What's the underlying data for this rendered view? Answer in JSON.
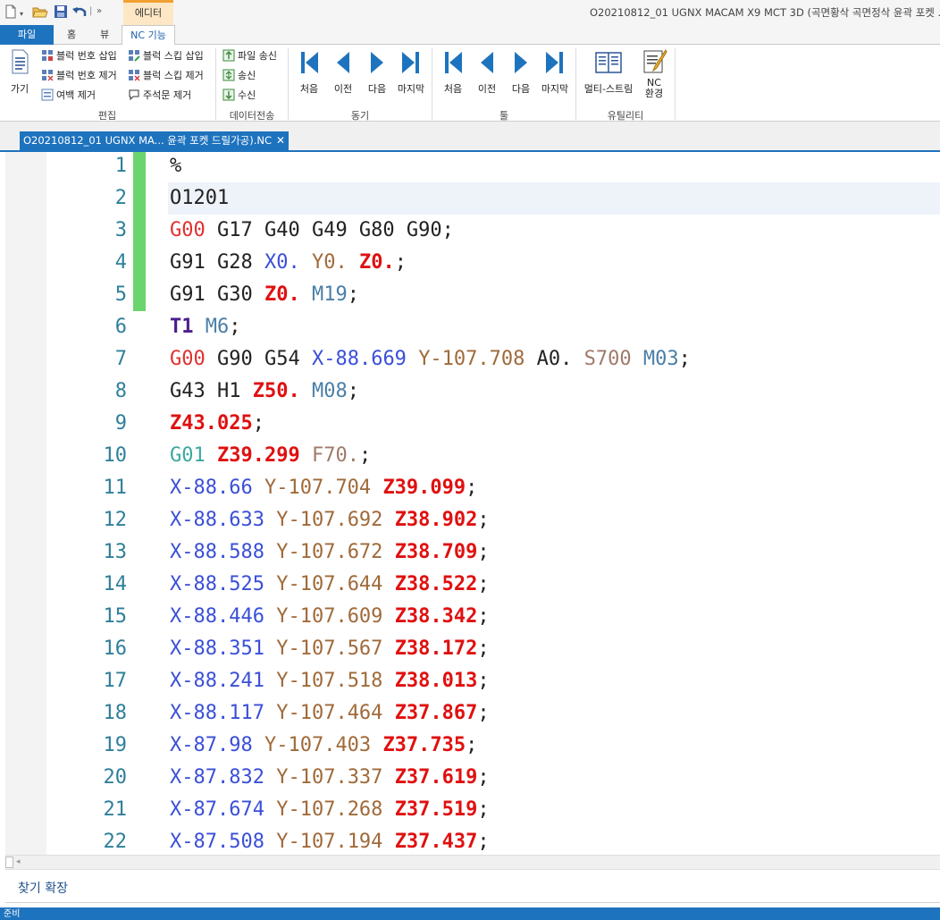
{
  "titlebar": {
    "context_tab": "에디터",
    "window_title": "O20210812_01 UGNX MACAM X9 MCT 3D (곡면황삭 곡면정삭 윤곽 포켓 ..."
  },
  "tabs": {
    "file": "파일",
    "home": "홈",
    "view": "뷰",
    "nc": "NC 기능"
  },
  "ribbon": {
    "go": "가기",
    "insert_block_number": "블럭 번호 삽입",
    "remove_block_number": "블럭 번호 제거",
    "remove_blank": "여백 제거",
    "insert_block_skip": "블럭 스킵 삽입",
    "remove_block_skip": "블럭 스킵 제거",
    "remove_comment": "주석문 제거",
    "edit_group": "편집",
    "send_file": "파일 송신",
    "send": "송신",
    "receive": "수신",
    "transfer_group": "데이터전송",
    "sync_first": "처음",
    "sync_prev": "이전",
    "sync_next": "다음",
    "sync_last": "마지막",
    "sync_group": "동기",
    "tool_first": "처음",
    "tool_prev": "이전",
    "tool_next": "다음",
    "tool_last": "마지막",
    "tool_group": "툴",
    "multi_stream": "멀티-스트림",
    "nc_env": "NC\n환경",
    "utility_group": "유틸리티"
  },
  "document_tab": {
    "title": "O20210812_01 UGNX MA... 윤곽 포켓 드릴가공).NC",
    "close": "✕"
  },
  "colors": {
    "g00": "#e03030",
    "g01": "#3aa8a0",
    "x": "#3a4fd8",
    "y": "#a06a3a",
    "z": "#e01010",
    "m": "#4a7fa8",
    "f": "#a07a6a",
    "t": "#4b1e8c",
    "line_number": "#2f7f9a",
    "default": "#222222"
  },
  "code_lines": [
    {
      "n": "1",
      "tokens": [
        {
          "t": "%",
          "c": "default"
        }
      ]
    },
    {
      "n": "2",
      "tokens": [
        {
          "t": "O1201",
          "c": "default"
        }
      ]
    },
    {
      "n": "3",
      "tokens": [
        {
          "t": "G00",
          "c": "g00"
        },
        {
          "t": " G17 G40 G49 G80 G90;",
          "c": "default"
        }
      ]
    },
    {
      "n": "4",
      "tokens": [
        {
          "t": "G91 G28 ",
          "c": "default"
        },
        {
          "t": "X0.",
          "c": "x"
        },
        {
          "t": " ",
          "c": "default"
        },
        {
          "t": "Y0.",
          "c": "y"
        },
        {
          "t": " ",
          "c": "default"
        },
        {
          "t": "Z0.",
          "c": "z",
          "b": true
        },
        {
          "t": ";",
          "c": "default"
        }
      ]
    },
    {
      "n": "5",
      "tokens": [
        {
          "t": "G91 G30 ",
          "c": "default"
        },
        {
          "t": "Z0.",
          "c": "z",
          "b": true
        },
        {
          "t": " ",
          "c": "default"
        },
        {
          "t": "M19",
          "c": "m"
        },
        {
          "t": ";",
          "c": "default"
        }
      ]
    },
    {
      "n": "6",
      "tokens": [
        {
          "t": "T1",
          "c": "t",
          "b": true
        },
        {
          "t": " ",
          "c": "default"
        },
        {
          "t": "M6",
          "c": "m"
        },
        {
          "t": ";",
          "c": "default"
        }
      ]
    },
    {
      "n": "7",
      "tokens": [
        {
          "t": "G00",
          "c": "g00"
        },
        {
          "t": " G90 G54 ",
          "c": "default"
        },
        {
          "t": "X-88.669",
          "c": "x"
        },
        {
          "t": " ",
          "c": "default"
        },
        {
          "t": "Y-107.708",
          "c": "y"
        },
        {
          "t": " A0. ",
          "c": "default"
        },
        {
          "t": "S700",
          "c": "f"
        },
        {
          "t": " ",
          "c": "default"
        },
        {
          "t": "M03",
          "c": "m"
        },
        {
          "t": ";",
          "c": "default"
        }
      ]
    },
    {
      "n": "8",
      "tokens": [
        {
          "t": "G43 H1 ",
          "c": "default"
        },
        {
          "t": "Z50.",
          "c": "z",
          "b": true
        },
        {
          "t": " ",
          "c": "default"
        },
        {
          "t": "M08",
          "c": "m"
        },
        {
          "t": ";",
          "c": "default"
        }
      ]
    },
    {
      "n": "9",
      "tokens": [
        {
          "t": "Z43.025",
          "c": "z",
          "b": true
        },
        {
          "t": ";",
          "c": "default"
        }
      ]
    },
    {
      "n": "10",
      "tokens": [
        {
          "t": "G01",
          "c": "g01"
        },
        {
          "t": " ",
          "c": "default"
        },
        {
          "t": "Z39.299",
          "c": "z",
          "b": true
        },
        {
          "t": " ",
          "c": "default"
        },
        {
          "t": "F70.",
          "c": "f"
        },
        {
          "t": ";",
          "c": "default"
        }
      ]
    },
    {
      "n": "11",
      "tokens": [
        {
          "t": "X-88.66",
          "c": "x"
        },
        {
          "t": " ",
          "c": "default"
        },
        {
          "t": "Y-107.704",
          "c": "y"
        },
        {
          "t": " ",
          "c": "default"
        },
        {
          "t": "Z39.099",
          "c": "z",
          "b": true
        },
        {
          "t": ";",
          "c": "default"
        }
      ]
    },
    {
      "n": "12",
      "tokens": [
        {
          "t": "X-88.633",
          "c": "x"
        },
        {
          "t": " ",
          "c": "default"
        },
        {
          "t": "Y-107.692",
          "c": "y"
        },
        {
          "t": " ",
          "c": "default"
        },
        {
          "t": "Z38.902",
          "c": "z",
          "b": true
        },
        {
          "t": ";",
          "c": "default"
        }
      ]
    },
    {
      "n": "13",
      "tokens": [
        {
          "t": "X-88.588",
          "c": "x"
        },
        {
          "t": " ",
          "c": "default"
        },
        {
          "t": "Y-107.672",
          "c": "y"
        },
        {
          "t": " ",
          "c": "default"
        },
        {
          "t": "Z38.709",
          "c": "z",
          "b": true
        },
        {
          "t": ";",
          "c": "default"
        }
      ]
    },
    {
      "n": "14",
      "tokens": [
        {
          "t": "X-88.525",
          "c": "x"
        },
        {
          "t": " ",
          "c": "default"
        },
        {
          "t": "Y-107.644",
          "c": "y"
        },
        {
          "t": " ",
          "c": "default"
        },
        {
          "t": "Z38.522",
          "c": "z",
          "b": true
        },
        {
          "t": ";",
          "c": "default"
        }
      ]
    },
    {
      "n": "15",
      "tokens": [
        {
          "t": "X-88.446",
          "c": "x"
        },
        {
          "t": " ",
          "c": "default"
        },
        {
          "t": "Y-107.609",
          "c": "y"
        },
        {
          "t": " ",
          "c": "default"
        },
        {
          "t": "Z38.342",
          "c": "z",
          "b": true
        },
        {
          "t": ";",
          "c": "default"
        }
      ]
    },
    {
      "n": "16",
      "tokens": [
        {
          "t": "X-88.351",
          "c": "x"
        },
        {
          "t": " ",
          "c": "default"
        },
        {
          "t": "Y-107.567",
          "c": "y"
        },
        {
          "t": " ",
          "c": "default"
        },
        {
          "t": "Z38.172",
          "c": "z",
          "b": true
        },
        {
          "t": ";",
          "c": "default"
        }
      ]
    },
    {
      "n": "17",
      "tokens": [
        {
          "t": "X-88.241",
          "c": "x"
        },
        {
          "t": " ",
          "c": "default"
        },
        {
          "t": "Y-107.518",
          "c": "y"
        },
        {
          "t": " ",
          "c": "default"
        },
        {
          "t": "Z38.013",
          "c": "z",
          "b": true
        },
        {
          "t": ";",
          "c": "default"
        }
      ]
    },
    {
      "n": "18",
      "tokens": [
        {
          "t": "X-88.117",
          "c": "x"
        },
        {
          "t": " ",
          "c": "default"
        },
        {
          "t": "Y-107.464",
          "c": "y"
        },
        {
          "t": " ",
          "c": "default"
        },
        {
          "t": "Z37.867",
          "c": "z",
          "b": true
        },
        {
          "t": ";",
          "c": "default"
        }
      ]
    },
    {
      "n": "19",
      "tokens": [
        {
          "t": "X-87.98",
          "c": "x"
        },
        {
          "t": " ",
          "c": "default"
        },
        {
          "t": "Y-107.403",
          "c": "y"
        },
        {
          "t": " ",
          "c": "default"
        },
        {
          "t": "Z37.735",
          "c": "z",
          "b": true
        },
        {
          "t": ";",
          "c": "default"
        }
      ]
    },
    {
      "n": "20",
      "tokens": [
        {
          "t": "X-87.832",
          "c": "x"
        },
        {
          "t": " ",
          "c": "default"
        },
        {
          "t": "Y-107.337",
          "c": "y"
        },
        {
          "t": " ",
          "c": "default"
        },
        {
          "t": "Z37.619",
          "c": "z",
          "b": true
        },
        {
          "t": ";",
          "c": "default"
        }
      ]
    },
    {
      "n": "21",
      "tokens": [
        {
          "t": "X-87.674",
          "c": "x"
        },
        {
          "t": " ",
          "c": "default"
        },
        {
          "t": "Y-107.268",
          "c": "y"
        },
        {
          "t": " ",
          "c": "default"
        },
        {
          "t": "Z37.519",
          "c": "z",
          "b": true
        },
        {
          "t": ";",
          "c": "default"
        }
      ]
    },
    {
      "n": "22",
      "tokens": [
        {
          "t": "X-87.508",
          "c": "x"
        },
        {
          "t": " ",
          "c": "default"
        },
        {
          "t": "Y-107.194",
          "c": "y"
        },
        {
          "t": " ",
          "c": "default"
        },
        {
          "t": "Z37.437",
          "c": "z",
          "b": true
        },
        {
          "t": ";",
          "c": "default"
        }
      ]
    }
  ],
  "find_bar": {
    "label": "찾기 확장"
  },
  "status": {
    "text": "준비"
  }
}
